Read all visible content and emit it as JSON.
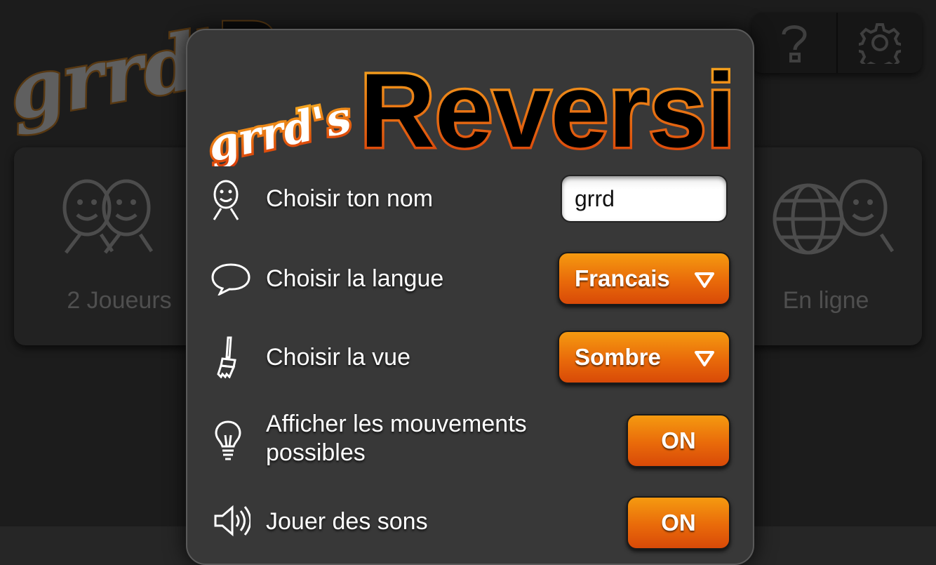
{
  "background": {
    "logo_prefix": "grrd'",
    "cards": [
      {
        "label": "2 Joueurs",
        "icon": "two-faces-icon"
      },
      {
        "label": "En ligne",
        "icon": "globe-face-icon"
      }
    ],
    "top_buttons": [
      {
        "icon": "question-icon"
      },
      {
        "icon": "gear-icon"
      }
    ]
  },
  "dialog": {
    "logo": {
      "prefix": "grrd's",
      "title": "Reversi"
    },
    "settings": [
      {
        "icon": "face-icon",
        "label": "Choisir ton nom",
        "control": "input",
        "value": "grrd"
      },
      {
        "icon": "speech-bubble-icon",
        "label": "Choisir la langue",
        "control": "dropdown",
        "value": "Francais"
      },
      {
        "icon": "brush-icon",
        "label": "Choisir la vue",
        "control": "dropdown",
        "value": "Sombre"
      },
      {
        "icon": "lightbulb-icon",
        "label_line1": "Afficher les mouvements",
        "label_line2": "possibles",
        "control": "toggle",
        "value": "ON"
      },
      {
        "icon": "speaker-icon",
        "label": "Jouer des sons",
        "control": "toggle",
        "value": "ON"
      }
    ]
  },
  "colors": {
    "accent_orange": "#e96a0a",
    "background": "#262626",
    "dialog": "#383838"
  }
}
